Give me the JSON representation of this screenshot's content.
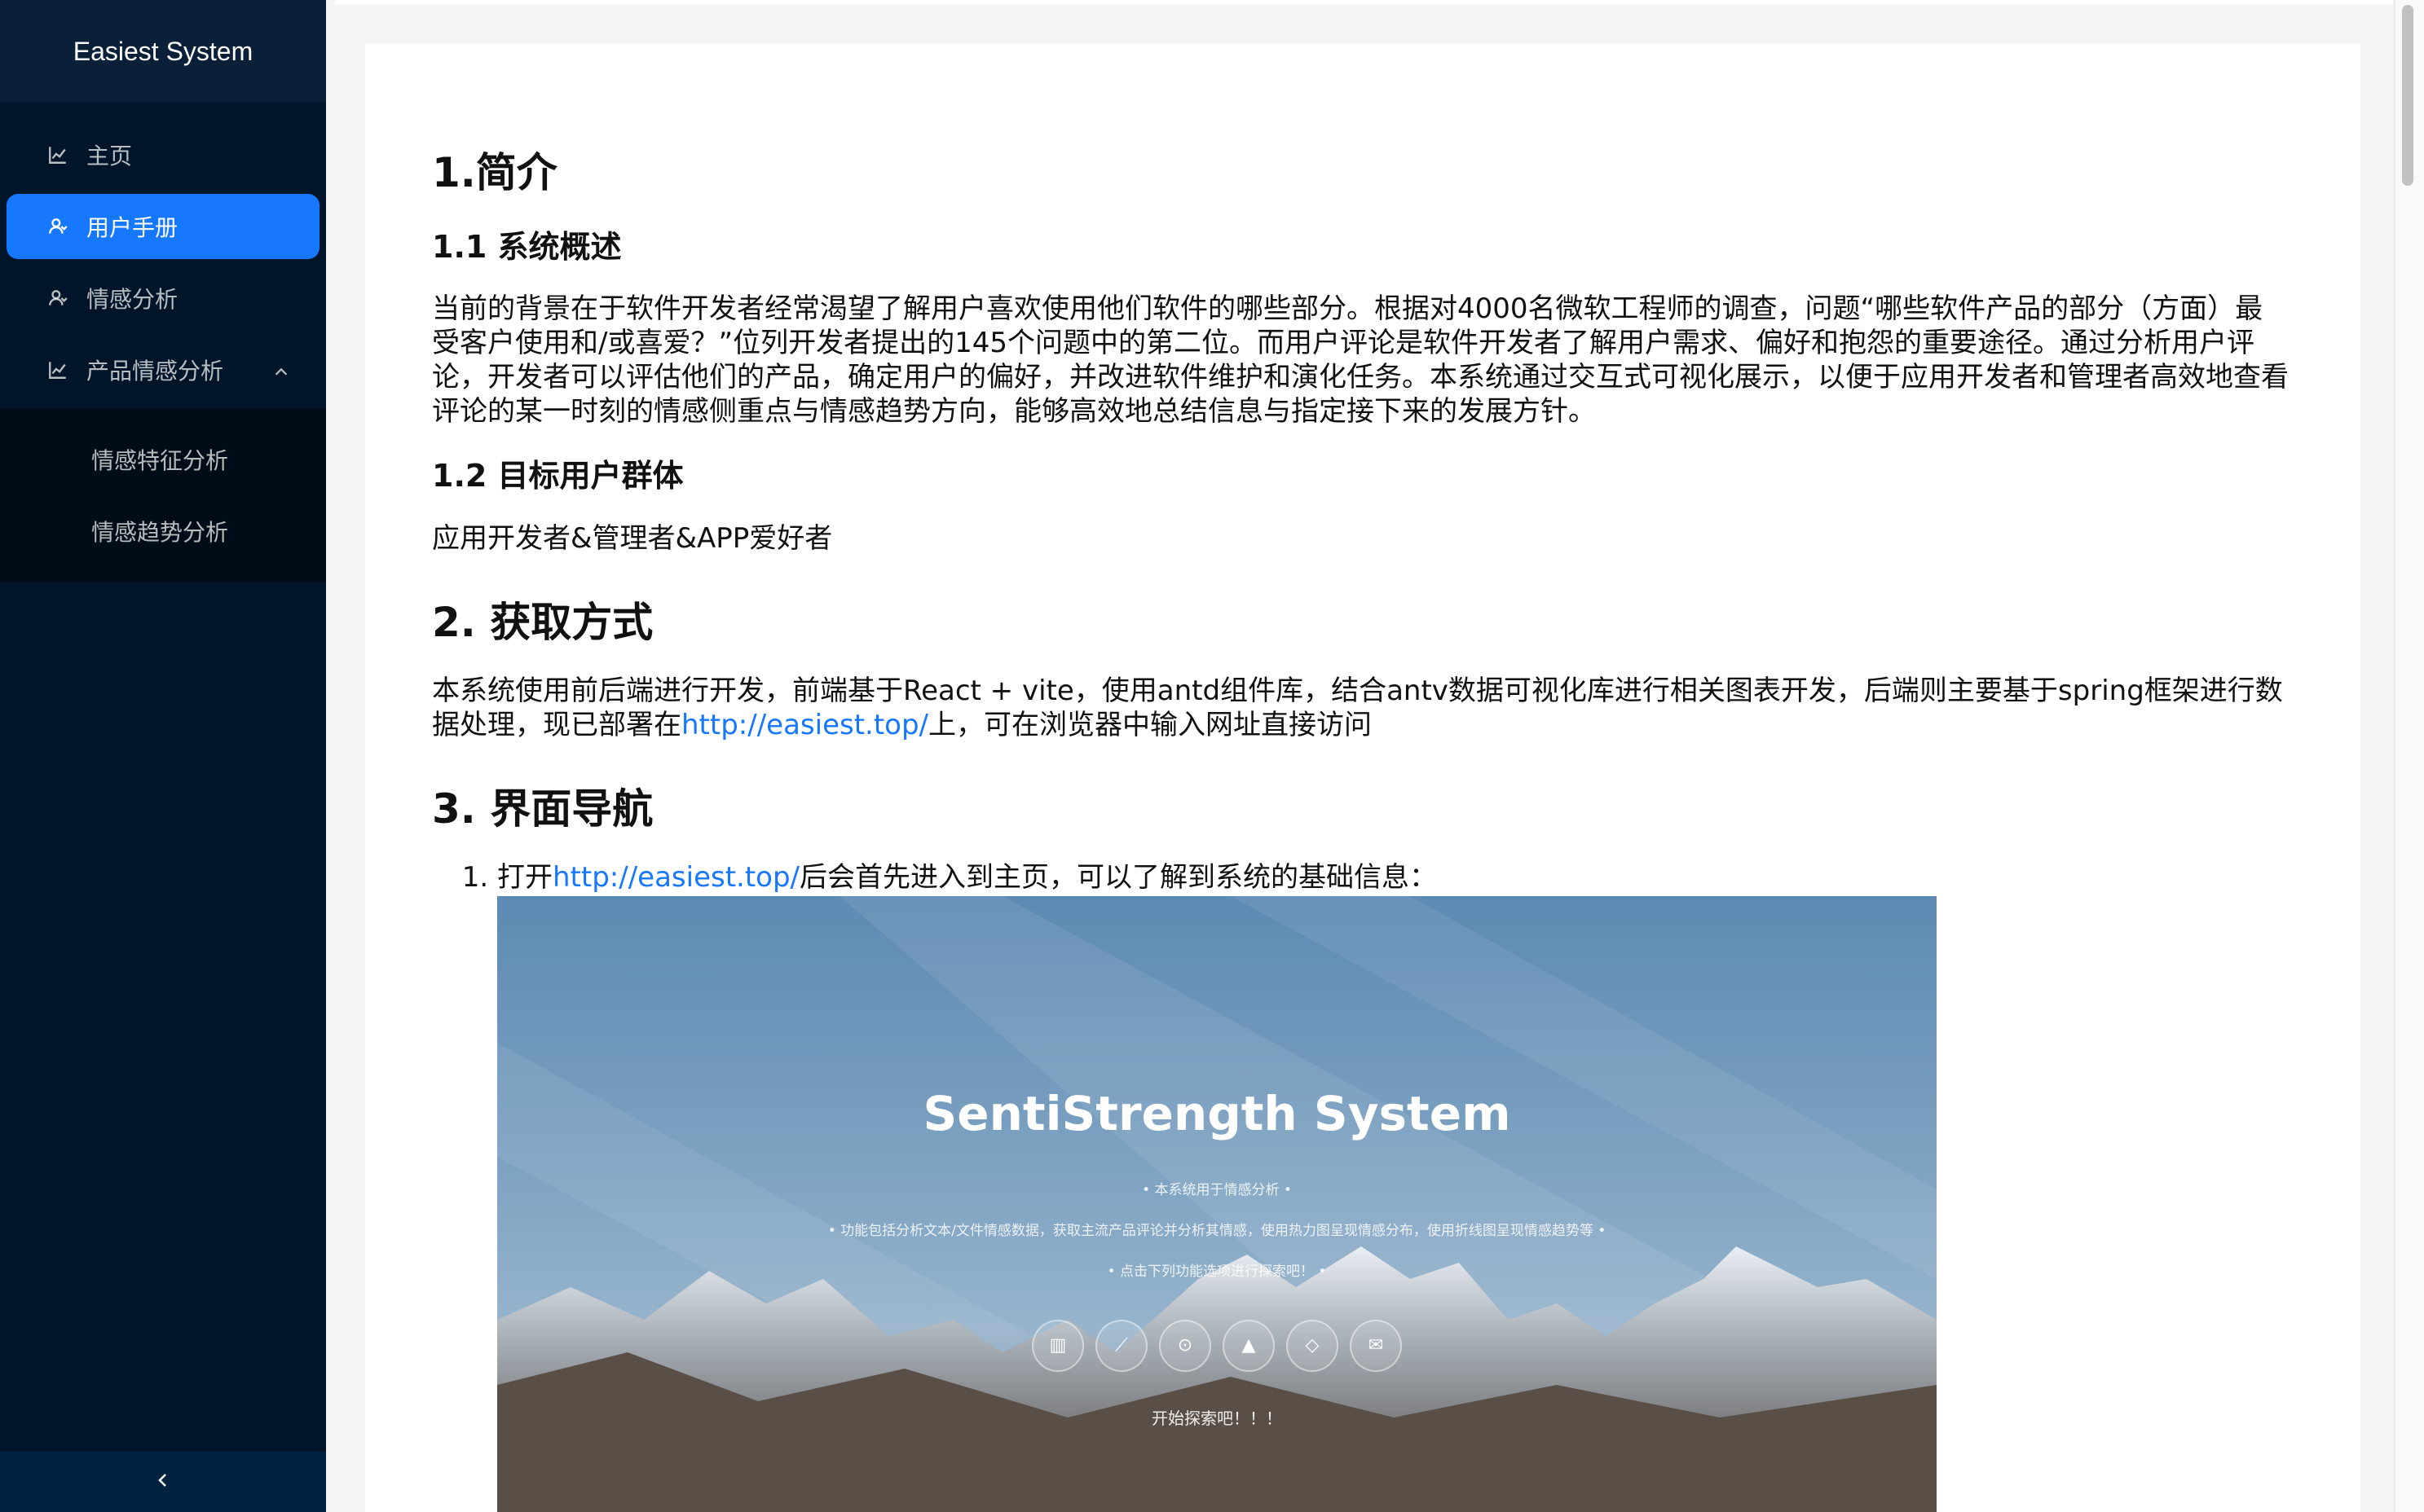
{
  "app": {
    "title": "Easiest System"
  },
  "sidebar": {
    "items": [
      {
        "label": "主页",
        "icon": "line-chart-icon"
      },
      {
        "label": "用户手册",
        "icon": "user-manual-icon",
        "active": true
      },
      {
        "label": "情感分析",
        "icon": "user-manual-icon"
      },
      {
        "label": "产品情感分析",
        "icon": "line-chart-icon",
        "expanded": true
      }
    ],
    "submenu": [
      {
        "label": "情感特征分析"
      },
      {
        "label": "情感趋势分析"
      }
    ],
    "collapse_icon": "chevron-left-icon"
  },
  "doc": {
    "h1_intro": "1.简介",
    "h2_overview": "1.1 系统概述",
    "p_overview": "当前的背景在于软件开发者经常渴望了解用户喜欢使用他们软件的哪些部分。根据对4000名微软工程师的调查，问题“哪些软件产品的部分（方面）最受客户使用和/或喜爱？”位列开发者提出的145个问题中的第二位。而用户评论是软件开发者了解用户需求、偏好和抱怨的重要途径。通过分析用户评论，开发者可以评估他们的产品，确定用户的偏好，并改进软件维护和演化任务。本系统通过交互式可视化展示，以便于应用开发者和管理者高效地查看评论的某一时刻的情感侧重点与情感趋势方向，能够高效地总结信息与指定接下来的发展方针。",
    "h2_users": "1.2 目标用户群体",
    "p_users": "应用开发者&管理者&APP爱好者",
    "h1_access": "2. 获取方式",
    "p_access_before": "本系统使用前后端进行开发，前端基于React + vite，使用antd组件库，结合antv数据可视化库进行相关图表开发，后端则主要基于spring框架进行数据处理，现已部署在",
    "p_access_link": "http://easiest.top/",
    "p_access_after": "上，可在浏览器中输入网址直接访问",
    "h1_nav": "3. 界面导航",
    "step1_before": "打开",
    "step1_link": "http://easiest.top/",
    "step1_after": "后会首先进入到主页，可以了解到系统的基础信息："
  },
  "screenshot": {
    "title": "SentiStrength System",
    "line1": "• 本系统用于情感分析 •",
    "line2": "• 功能包括分析文本/文件情感数据，获取主流产品评论并分析其情感，使用热力图呈现情感分布，使用折线图呈现情感趋势等 •",
    "line3": "• 点击下列功能选项进行探索吧！ •",
    "explore": "开始探索吧！！！",
    "icons": [
      "book-icon",
      "line-chart-icon",
      "search-icon",
      "area-chart-icon",
      "tag-icon",
      "mail-icon"
    ]
  },
  "colors": {
    "sidebar_bg": "#001529",
    "accent": "#1677ff",
    "link": "#1677ff"
  }
}
